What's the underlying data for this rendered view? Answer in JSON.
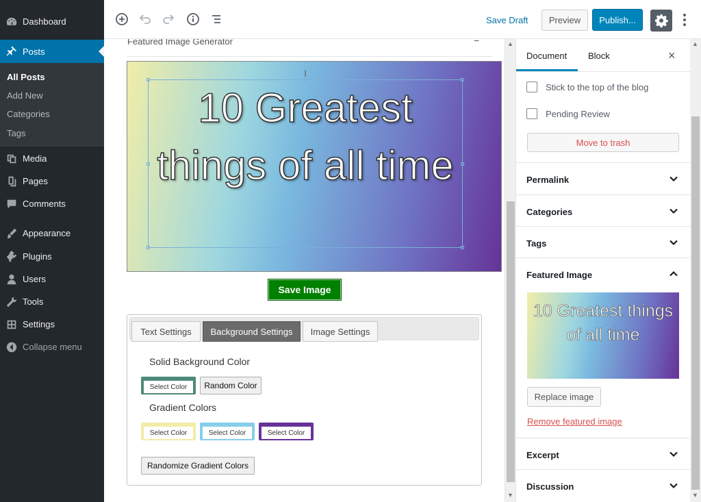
{
  "admin_menu": {
    "items": [
      {
        "label": "Dashboard",
        "icon": "dashboard-icon"
      },
      {
        "label": "Posts",
        "icon": "pin-icon"
      },
      {
        "label": "Media",
        "icon": "media-icon"
      },
      {
        "label": "Pages",
        "icon": "pages-icon"
      },
      {
        "label": "Comments",
        "icon": "comments-icon"
      },
      {
        "label": "Appearance",
        "icon": "brush-icon"
      },
      {
        "label": "Plugins",
        "icon": "plugin-icon"
      },
      {
        "label": "Users",
        "icon": "users-icon"
      },
      {
        "label": "Tools",
        "icon": "wrench-icon"
      },
      {
        "label": "Settings",
        "icon": "settings-icon"
      },
      {
        "label": "Collapse menu",
        "icon": "collapse-icon"
      }
    ],
    "submenu": [
      "All Posts",
      "Add New",
      "Categories",
      "Tags"
    ],
    "active_color": "#0073aa"
  },
  "toolbar": {
    "save_draft": "Save Draft",
    "preview": "Preview",
    "publish": "Publish..."
  },
  "editor": {
    "block_title": "Featured Image Generator",
    "collapse_symbol": "−",
    "canvas_text": "10 Greatest things of all time",
    "save_image": "Save Image",
    "tabs": [
      "Text Settings",
      "Background Settings",
      "Image Settings"
    ],
    "active_tab": "Background Settings",
    "solid_label": "Solid Background Color",
    "gradient_label": "Gradient Colors",
    "select_color": "Select Color",
    "random_color": "Random Color",
    "randomize_gradient": "Randomize Gradient Colors",
    "solid_color": "#4e8a79",
    "gradient_colors": [
      "#f1eda7",
      "#87ceeb",
      "#663399"
    ]
  },
  "sidebar": {
    "tab_document": "Document",
    "tab_block": "Block",
    "close": "×",
    "stick_top": "Stick to the top of the blog",
    "pending_review": "Pending Review",
    "move_to_trash": "Move to trash",
    "sections": {
      "permalink": "Permalink",
      "categories": "Categories",
      "tags": "Tags",
      "featured_image": "Featured Image",
      "excerpt": "Excerpt",
      "discussion": "Discussion"
    },
    "thumb_text": "10 Greatest things of all time",
    "replace_image": "Replace image",
    "remove_featured": "Remove featured image"
  }
}
